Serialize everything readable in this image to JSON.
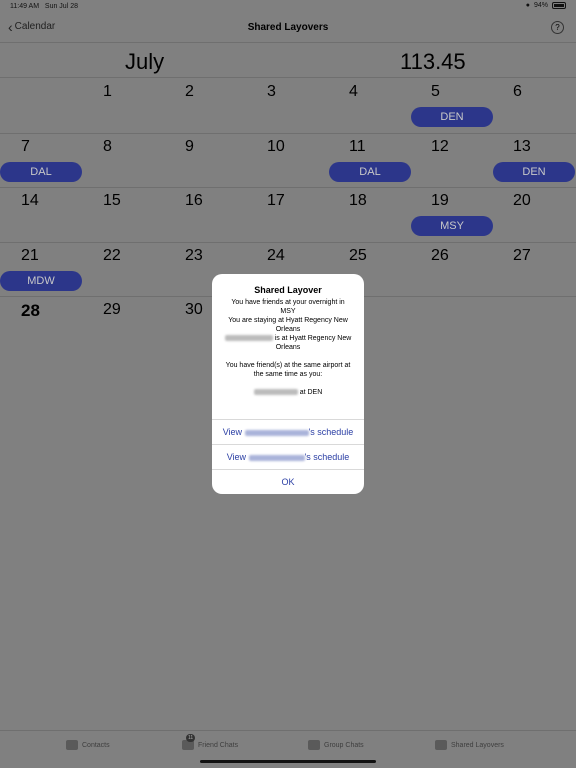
{
  "status_bar": {
    "time": "11:49 AM",
    "date": "Sun Jul 28",
    "battery": "94%"
  },
  "nav": {
    "back_label": "Calendar",
    "title": "Shared Layovers",
    "help": "?"
  },
  "calendar": {
    "month": "July",
    "value": "113.45",
    "weeks": [
      [
        {
          "d": "1"
        },
        {
          "d": "2"
        },
        {
          "d": "3"
        },
        {
          "d": "4"
        },
        {
          "d": "5",
          "tag": "DEN"
        },
        {
          "d": "6"
        }
      ],
      [
        {
          "d": "7",
          "tag": "DAL"
        },
        {
          "d": "8"
        },
        {
          "d": "9"
        },
        {
          "d": "10"
        },
        {
          "d": "11",
          "tag": "DAL"
        },
        {
          "d": "12"
        },
        {
          "d": "13",
          "tag": "DEN"
        }
      ],
      [
        {
          "d": "14"
        },
        {
          "d": "15"
        },
        {
          "d": "16"
        },
        {
          "d": "17"
        },
        {
          "d": "18"
        },
        {
          "d": "19",
          "tag": "MSY"
        },
        {
          "d": "20"
        }
      ],
      [
        {
          "d": "21",
          "tag": "MDW"
        },
        {
          "d": "22"
        },
        {
          "d": "23"
        },
        {
          "d": "24"
        },
        {
          "d": "25"
        },
        {
          "d": "26"
        },
        {
          "d": "27"
        }
      ],
      [
        {
          "d": "28"
        },
        {
          "d": "29"
        },
        {
          "d": "30"
        }
      ]
    ]
  },
  "modal": {
    "title": "Shared Layover",
    "line1": "You have friends at your overnight in MSY",
    "line2": "You are staying at Hyatt Regency New Orleans",
    "line3": "is at Hyatt Regency New Orleans",
    "line4": "You have friend(s) at the same airport at the same time as you:",
    "line5": "at DEN",
    "btn1_prefix": "View",
    "btn1_suffix": "'s schedule",
    "btn2_prefix": "View",
    "btn2_suffix": "'s schedule",
    "ok": "OK"
  },
  "tabs": {
    "contacts": "Contacts",
    "friend_chats": "Friend Chats",
    "friend_chats_badge": "11",
    "group_chats": "Group Chats",
    "shared_layovers": "Shared Layovers"
  }
}
